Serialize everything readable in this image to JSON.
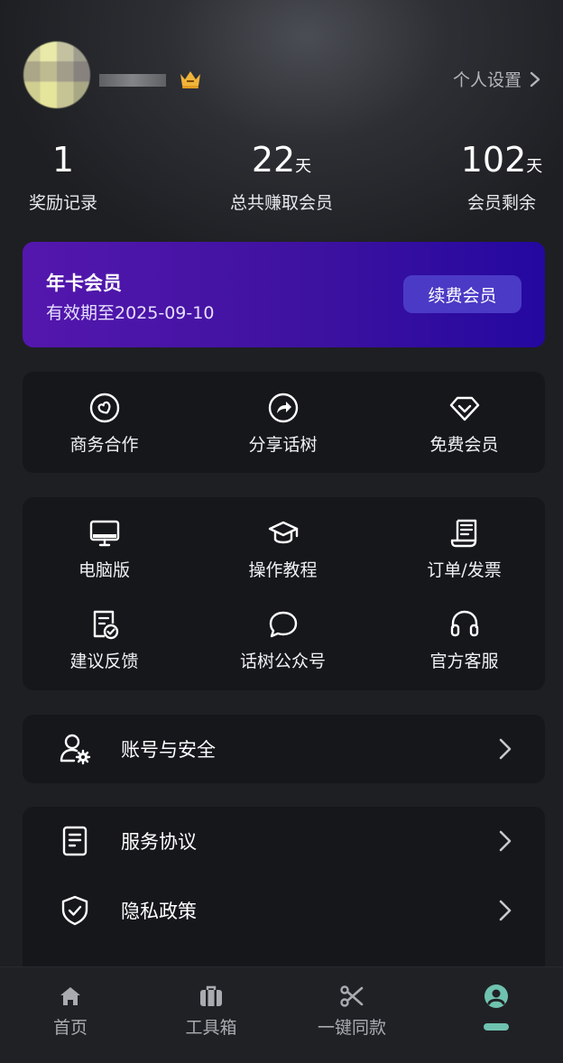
{
  "header": {
    "settings_label": "个人设置"
  },
  "stats": [
    {
      "value": "1",
      "unit": "",
      "label": "奖励记录"
    },
    {
      "value": "22",
      "unit": "天",
      "label": "总共赚取会员"
    },
    {
      "value": "102",
      "unit": "天",
      "label": "会员剩余"
    }
  ],
  "membership": {
    "title": "年卡会员",
    "expiry": "有效期至2025-09-10",
    "renew_label": "续费会员"
  },
  "quick_actions": [
    {
      "label": "商务合作",
      "icon": "heart-circle-icon"
    },
    {
      "label": "分享话树",
      "icon": "share-icon"
    },
    {
      "label": "免费会员",
      "icon": "diamond-icon"
    }
  ],
  "tools": [
    {
      "label": "电脑版",
      "icon": "desktop-icon"
    },
    {
      "label": "操作教程",
      "icon": "graduation-cap-icon"
    },
    {
      "label": "订单/发票",
      "icon": "receipt-icon"
    },
    {
      "label": "建议反馈",
      "icon": "feedback-icon"
    },
    {
      "label": "话树公众号",
      "icon": "chat-bubble-icon"
    },
    {
      "label": "官方客服",
      "icon": "headset-icon"
    }
  ],
  "account": {
    "label": "账号与安全",
    "icon": "user-gear-icon"
  },
  "legal": [
    {
      "label": "服务协议",
      "icon": "document-icon"
    },
    {
      "label": "隐私政策",
      "icon": "shield-check-icon"
    }
  ],
  "nav": [
    {
      "label": "首页",
      "icon": "home-icon"
    },
    {
      "label": "工具箱",
      "icon": "toolbox-icon"
    },
    {
      "label": "一键同款",
      "icon": "scissors-icon"
    },
    {
      "label": "",
      "icon": "profile-icon",
      "active": true
    }
  ],
  "colors": {
    "accent": "#6fc2b0",
    "vip_start": "#5417ae",
    "vip_end": "#2408a0",
    "renew_button": "#4b3ac6",
    "crown": "#f0b43a"
  }
}
